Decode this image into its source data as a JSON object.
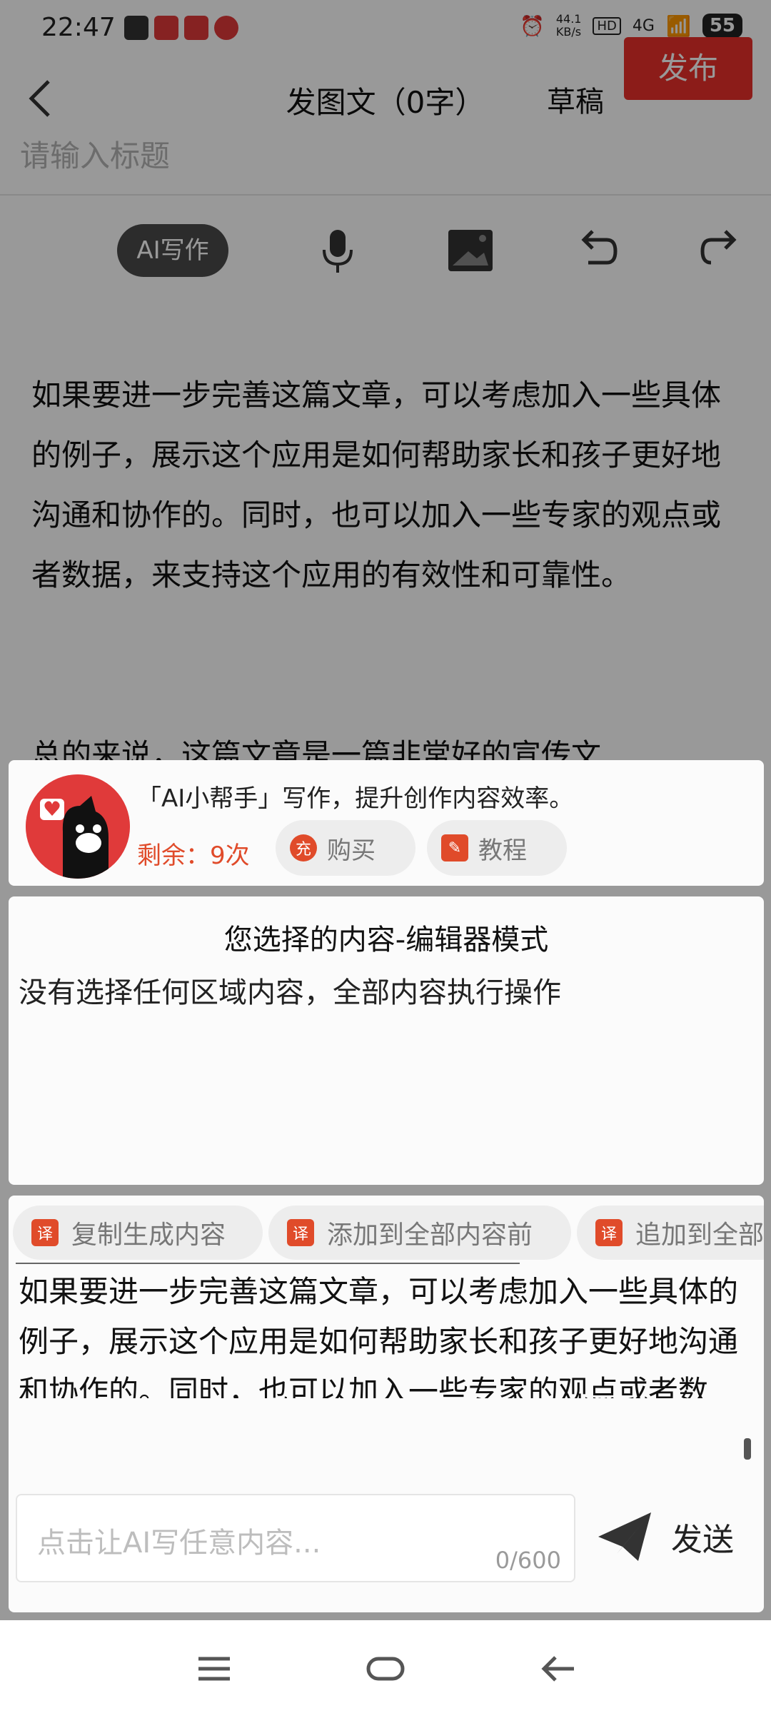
{
  "status": {
    "time": "22:47",
    "net_speed_top": "44.1",
    "net_speed_unit": "KB/s",
    "hd_label": "HD",
    "signal_label": "4G",
    "battery": "55"
  },
  "header": {
    "title": "发图文（0字）",
    "draft_label": "草稿",
    "publish_label": "发布"
  },
  "editor": {
    "title_placeholder": "请输入标题",
    "ai_button_label": "AI写作",
    "paragraph1": "如果要进一步完善这篇文章，可以考虑加入一些具体的例子，展示这个应用是如何帮助家长和孩子更好地沟通和协作的。同时，也可以加入一些专家的观点或者数据，来支持这个应用的有效性和可靠性。",
    "paragraph2": "总的来说，这篇文章是一篇非常好的宣传文"
  },
  "assistant": {
    "title": "「AI小帮手」写作，提升创作内容效率。",
    "remaining": "剩余：9次",
    "buy_label": "购买",
    "buy_icon": "充",
    "tutorial_label": "教程"
  },
  "selection": {
    "title": "您选择的内容-编辑器模式",
    "body": "没有选择任何区域内容，全部内容执行操作"
  },
  "actions": {
    "icon": "译",
    "items": [
      "复制生成内容",
      "添加到全部内容前",
      "追加到全部"
    ]
  },
  "generated_text": "如果要进一步完善这篇文章，可以考虑加入一些具体的例子，展示这个应用是如何帮助家长和孩子更好地沟通和协作的。同时，也可以加入一些专家的观点或者数据，来支持这个应用的有效性和可靠性。",
  "composer": {
    "placeholder": "点击让AI写任意内容...",
    "counter": "0/600",
    "send_label": "发送"
  },
  "colors": {
    "accent": "#e9302a",
    "overlay": "rgba(0,0,0,0.40)"
  }
}
